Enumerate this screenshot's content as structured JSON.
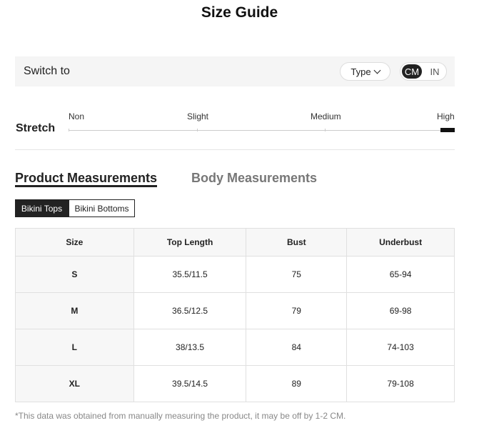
{
  "title": "Size Guide",
  "switch_bar": {
    "label": "Switch to",
    "type_button": "Type",
    "units": [
      "CM",
      "IN"
    ],
    "selected_unit": "CM"
  },
  "stretch": {
    "label": "Stretch",
    "levels": [
      "Non",
      "Slight",
      "Medium",
      "High"
    ],
    "selected_level": "High"
  },
  "measurement_tabs": {
    "product": "Product Measurements",
    "body": "Body Measurements",
    "active": "Product Measurements"
  },
  "sub_tabs": {
    "tops": "Bikini Tops",
    "bottoms": "Bikini Bottoms",
    "active": "Bikini Tops"
  },
  "table": {
    "headers": [
      "Size",
      "Top Length",
      "Bust",
      "Underbust"
    ],
    "rows": [
      [
        "S",
        "35.5/11.5",
        "75",
        "65-94"
      ],
      [
        "M",
        "36.5/12.5",
        "79",
        "69-98"
      ],
      [
        "L",
        "38/13.5",
        "84",
        "74-103"
      ],
      [
        "XL",
        "39.5/14.5",
        "89",
        "79-108"
      ]
    ]
  },
  "footnote": "*This data was obtained from manually measuring the product, it may be off by 1-2 CM.",
  "colors": {
    "accent": "#222222",
    "bar_background": "#f5f5f5",
    "table_header": "#f7f7f7"
  },
  "icons": {
    "type_dropdown": "chevron-down-icon"
  }
}
